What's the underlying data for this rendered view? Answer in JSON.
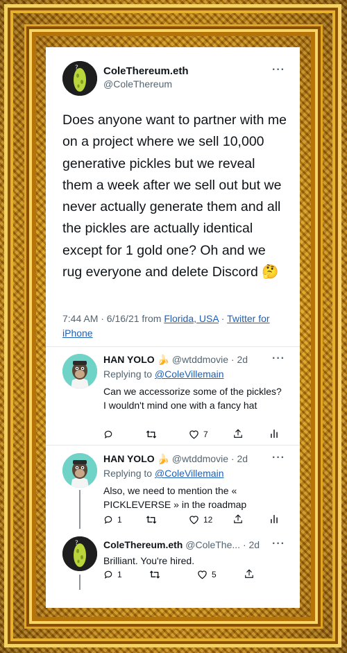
{
  "main_tweet": {
    "display_name": "ColeThereum.eth",
    "handle": "@ColeThereum",
    "text": "Does anyone want to partner with me on a project where we sell 10,000 generative pickles but we reveal them a week after we sell out but we never actually generate them and all the pickles are actually identical except for 1 gold one? Oh and we rug everyone and delete Discord",
    "emoji": "🤔",
    "time": "7:44 AM · 6/16/21",
    "from_label": "from",
    "location": "Florida, USA",
    "separator": "·",
    "source": "Twitter for iPhone",
    "more": "···"
  },
  "replies": [
    {
      "display_name": "HAN YOLO",
      "emoji": "🍌",
      "handle": "@wtddmovie",
      "age": "· 2d",
      "replying_label": "Replying to",
      "replying_to": "@ColeVillemain",
      "text": "Can we accessorize some of the pickles? I wouldn't mind one with a fancy hat",
      "reply_count": "",
      "retweet_count": "",
      "like_count": "7",
      "more": "···"
    },
    {
      "display_name": "HAN YOLO",
      "emoji": "🍌",
      "handle": "@wtddmovie",
      "age": "· 2d",
      "replying_label": "Replying to",
      "replying_to": "@ColeVillemain",
      "text": "Also, we need to mention the « PICKLEVERSE » in the roadmap",
      "reply_count": "1",
      "retweet_count": "",
      "like_count": "12",
      "more": "···"
    },
    {
      "display_name": "ColeThereum.eth",
      "handle": "@ColeThe...",
      "age": "· 2d",
      "text": "Brilliant. You're hired.",
      "reply_count": "1",
      "retweet_count": "",
      "like_count": "5",
      "more": "···"
    }
  ],
  "colors": {
    "link": "#1d5fb8",
    "muted": "#536471",
    "frame_gold": "#d99510",
    "avatar_pickle_bg": "#1e1e1e",
    "pickle_green": "#b9d63a",
    "ape_bg": "#6fd3c8"
  },
  "icons": [
    "reply-icon",
    "retweet-icon",
    "like-icon",
    "share-icon",
    "analytics-icon",
    "more-icon"
  ]
}
